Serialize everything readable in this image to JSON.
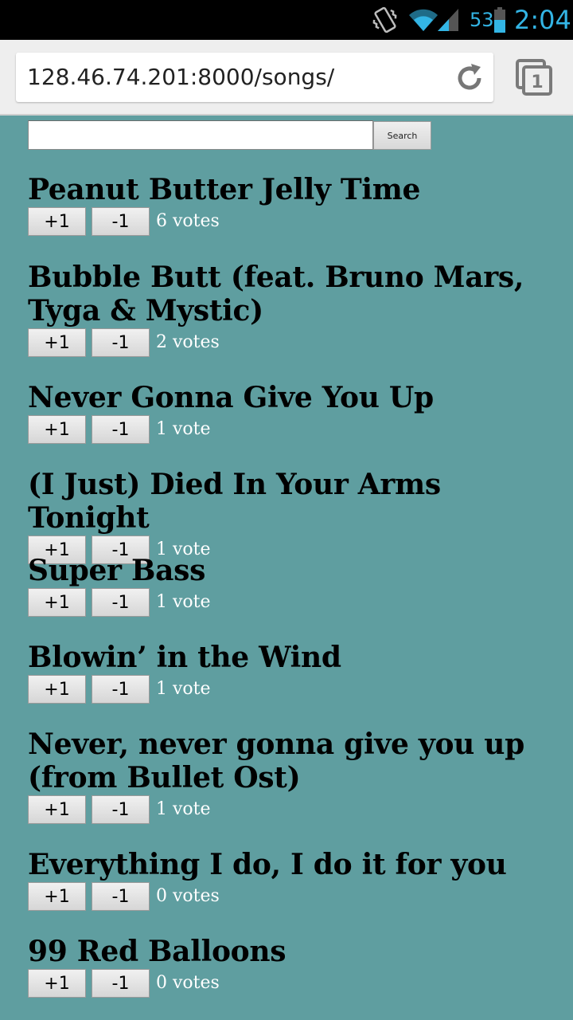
{
  "status_bar": {
    "battery_level": "53",
    "time": "2:04",
    "icons": [
      "vibrate-icon",
      "wifi-icon",
      "signal-icon",
      "battery-icon"
    ]
  },
  "browser": {
    "url": "128.46.74.201:8000/songs/",
    "tab_count": "1"
  },
  "search": {
    "value": "",
    "button_label": "Search"
  },
  "vote_labels": {
    "up": "+1",
    "down": "-1"
  },
  "songs": [
    {
      "title": "Peanut Butter Jelly Time",
      "votes": "6 votes"
    },
    {
      "title": "Bubble Butt (feat. Bruno Mars, Tyga & Mystic)",
      "votes": "2 votes"
    },
    {
      "title": "Never Gonna Give You Up",
      "votes": "1 vote"
    },
    {
      "title": "(I Just) Died In Your Arms Tonight",
      "votes": "1 vote"
    },
    {
      "title": "Super Bass",
      "votes": "1 vote"
    },
    {
      "title": "Blowin’ in the Wind",
      "votes": "1 vote"
    },
    {
      "title": "Never, never gonna give you up (from Bullet Ost)",
      "votes": "1 vote"
    },
    {
      "title": "Everything I do, I do it for you",
      "votes": "0 votes"
    },
    {
      "title": "99 Red Balloons",
      "votes": "0 votes"
    }
  ],
  "colors": {
    "page_background": "#5f9ea0",
    "status_accent": "#33b5e5"
  }
}
